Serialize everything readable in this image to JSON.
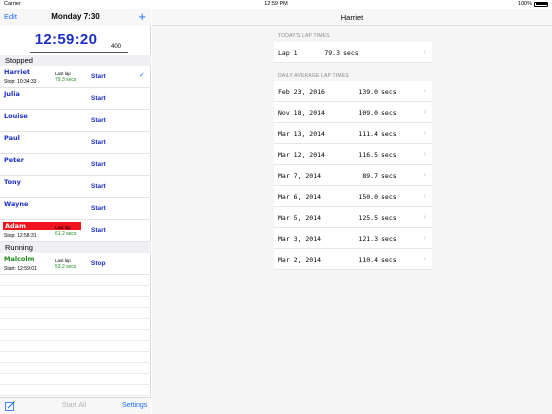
{
  "status_bar": {
    "carrier": "Carrier",
    "time": "12:59 PM",
    "battery": "100%"
  },
  "left": {
    "edit": "Edit",
    "title": "Monday 7:30",
    "add": "+",
    "clock": "12:59:20",
    "distance": "400",
    "sections": {
      "stopped": "Stopped",
      "running": "Running"
    },
    "runners": [
      {
        "name": "Harriet",
        "sub": "Stop: 10:34:33",
        "last_lap_label": "Last lap",
        "last_lap": "79.3 secs",
        "action": "Start",
        "checked": true
      },
      {
        "name": "Julia",
        "action": "Start"
      },
      {
        "name": "Louise",
        "action": "Start"
      },
      {
        "name": "Paul",
        "action": "Start"
      },
      {
        "name": "Peter",
        "action": "Start"
      },
      {
        "name": "Tony",
        "action": "Start"
      },
      {
        "name": "Wayne",
        "action": "Start"
      },
      {
        "name": "Adam",
        "sub": "Stop: 12:58:31",
        "last_lap_label": "Last lap",
        "last_lap": "61.2 secs",
        "action": "Start"
      },
      {
        "name": "Malcolm",
        "sub": "Start: 12:59:01",
        "last_lap_label": "Last lap",
        "last_lap": "53.2 secs",
        "action": "Stop"
      }
    ],
    "toolbar": {
      "start_all": "Start All",
      "settings": "Settings"
    }
  },
  "right": {
    "title": "Harriet",
    "today_header": "TODAY'S LAP TIMES",
    "today": [
      {
        "label": "Lap 1",
        "value": "79.3",
        "unit": "secs"
      }
    ],
    "daily_header": "DAILY AVERAGE LAP TIMES",
    "daily": [
      {
        "label": "Feb 23, 2016",
        "value": "139.0",
        "unit": "secs"
      },
      {
        "label": "Nov 18, 2014",
        "value": "109.0",
        "unit": "secs"
      },
      {
        "label": "Mar 13, 2014",
        "value": "111.4",
        "unit": "secs"
      },
      {
        "label": "Mar 12, 2014",
        "value": "116.5",
        "unit": "secs"
      },
      {
        "label": "Mar 7, 2014",
        "value": "89.7",
        "unit": "secs"
      },
      {
        "label": "Mar 6, 2014",
        "value": "150.0",
        "unit": "secs"
      },
      {
        "label": "Mar 5, 2014",
        "value": "125.5",
        "unit": "secs"
      },
      {
        "label": "Mar 3, 2014",
        "value": "121.3",
        "unit": "secs"
      },
      {
        "label": "Mar 2, 2014",
        "value": "110.4",
        "unit": "secs"
      }
    ]
  },
  "colors": {
    "accent": "#1a6dff",
    "runner_name": "#1b2fc8",
    "running_green": "#1d8a1d",
    "alert_red": "#f0141e"
  }
}
